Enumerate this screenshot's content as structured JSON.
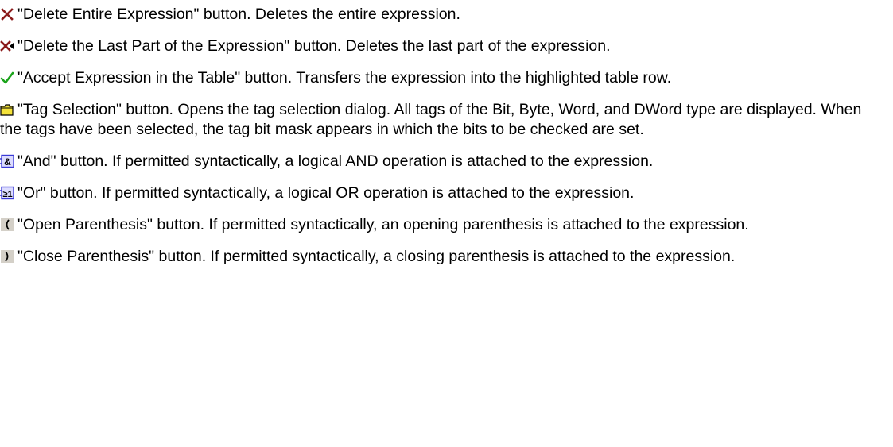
{
  "entries": [
    {
      "icon": "delete-entire-expression-icon",
      "text": "\"Delete Entire Expression\" button. Deletes the entire expression."
    },
    {
      "icon": "delete-last-part-icon",
      "text": "\"Delete the Last Part of the Expression\" button. Deletes the last part of the expression."
    },
    {
      "icon": "accept-checkmark-icon",
      "text": "\"Accept Expression in the Table\" button. Transfers the expression into the highlighted table row."
    },
    {
      "icon": "tag-selection-folder-icon",
      "text": "\"Tag Selection\" button. Opens the tag selection dialog. All tags of the Bit, Byte, Word, and DWord type are displayed. When the tags have been selected, the tag bit mask appears in which the bits to be checked are set."
    },
    {
      "icon": "and-operator-icon",
      "text": "\"And\" button. If permitted syntactically, a logical AND operation is attached to the expression."
    },
    {
      "icon": "or-operator-icon",
      "text": "\"Or\" button. If permitted syntactically, a logical OR operation is attached to the expression."
    },
    {
      "icon": "open-parenthesis-icon",
      "text": "\"Open Parenthesis\" button. If permitted syntactically, an opening parenthesis is attached to the expression."
    },
    {
      "icon": "close-parenthesis-icon",
      "text": "\"Close Parenthesis\" button. If permitted syntactically, a closing parenthesis is attached to the expression."
    }
  ],
  "colors": {
    "delete_red": "#8b1a1a",
    "accept_green": "#1aa31a",
    "folder_yellow": "#f4e23a",
    "operator_blue": "#3b3bd6",
    "button_gray": "#d4d0c8"
  }
}
